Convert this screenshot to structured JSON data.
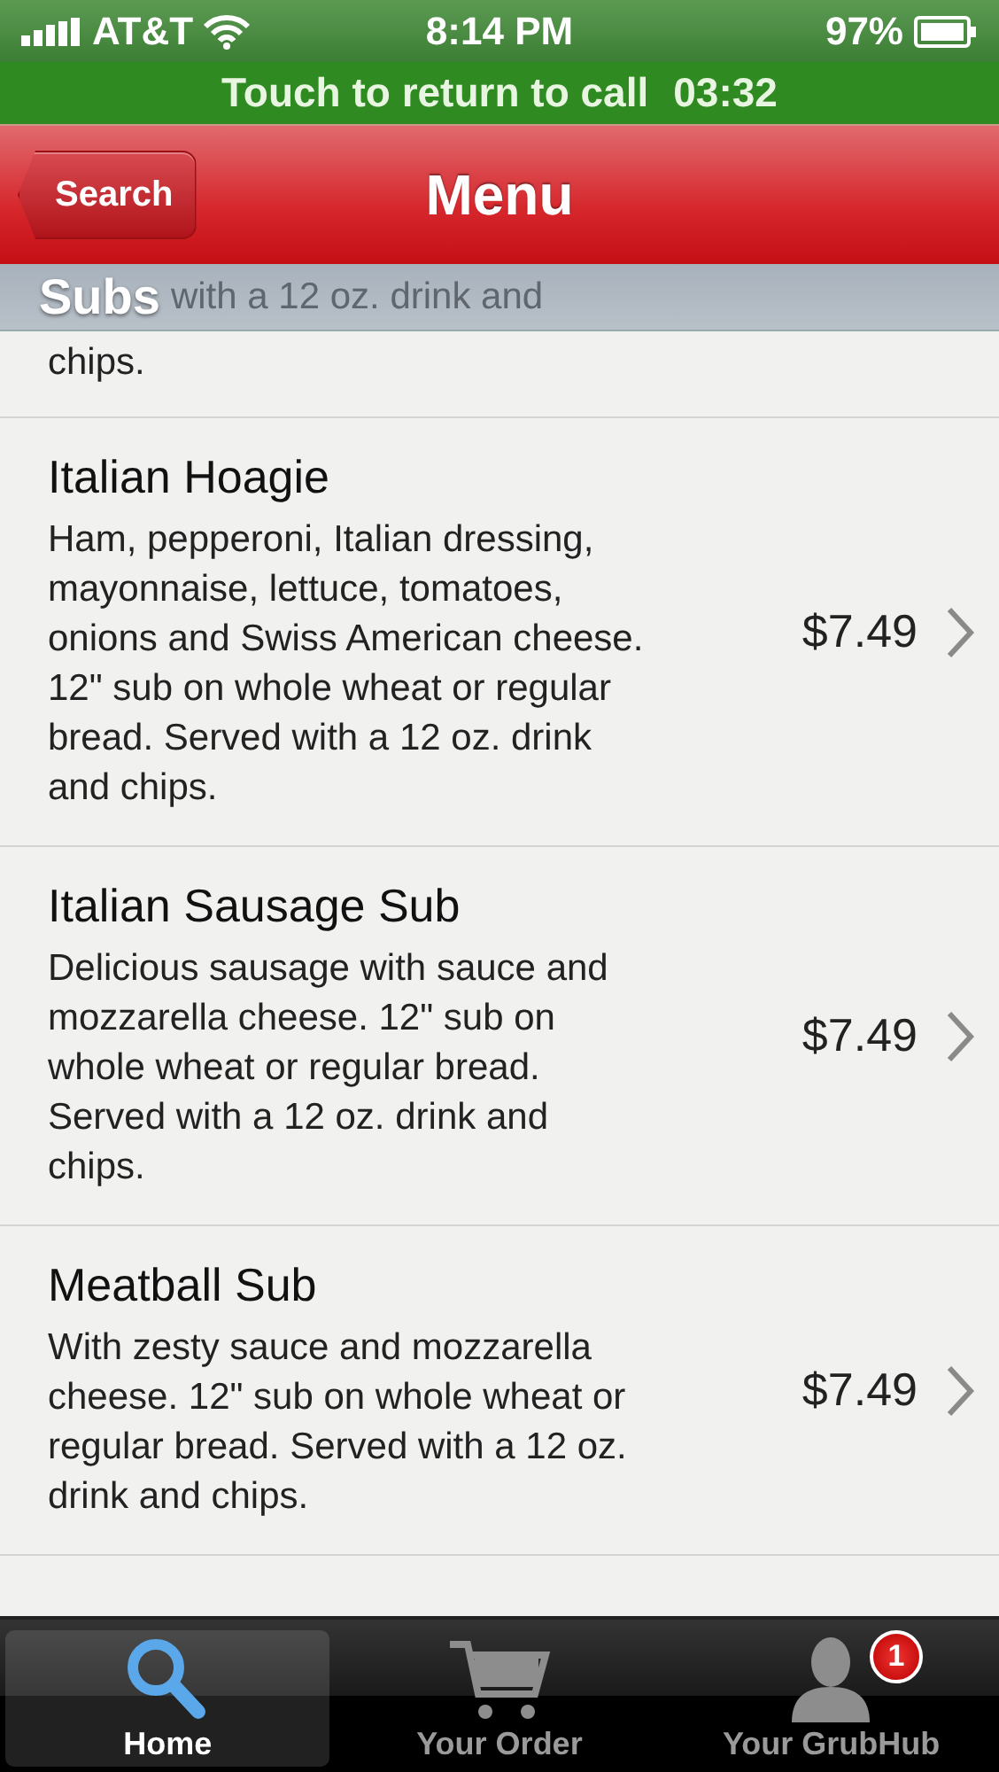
{
  "status_bar": {
    "carrier": "AT&T",
    "time": "8:14 PM",
    "battery": "97%"
  },
  "call_banner": {
    "text": "Touch to return to call",
    "timer": "03:32"
  },
  "nav_bar": {
    "back_button": "Search",
    "title": "Menu"
  },
  "section": {
    "title": "Subs",
    "faded_text": "with a 12 oz. drink and"
  },
  "items": [
    {
      "kind": "partial",
      "description": "chips."
    },
    {
      "kind": "full",
      "name": "Italian Hoagie",
      "description": "Ham, pepperoni, Italian dressing, mayonnaise, lettuce, tomatoes, onions and Swiss American cheese. 12\" sub on whole wheat or regular bread. Served with a 12 oz. drink and chips.",
      "price": "$7.49"
    },
    {
      "kind": "full",
      "name": "Italian Sausage Sub",
      "description": "Delicious sausage with sauce and mozzarella cheese. 12\" sub on whole wheat or regular bread. Served with a 12 oz. drink and chips.",
      "price": "$7.49"
    },
    {
      "kind": "full",
      "name": "Meatball Sub",
      "description": "With zesty sauce and mozzarella cheese. 12\" sub on whole wheat or regular bread. Served with a 12 oz. drink and chips.",
      "price": "$7.49"
    }
  ],
  "tab_bar": [
    {
      "label": "Home",
      "kind": "search",
      "selected": true
    },
    {
      "label": "Your Order",
      "kind": "cart",
      "selected": false
    },
    {
      "label": "Your GrubHub",
      "kind": "person",
      "selected": false,
      "badge": "1"
    }
  ]
}
